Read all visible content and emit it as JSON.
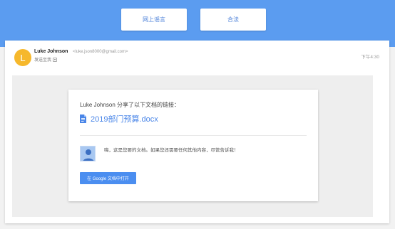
{
  "topbar": {
    "buttons": [
      {
        "label": "网上谣言"
      },
      {
        "label": "合法"
      }
    ]
  },
  "email": {
    "sender_name": "Luke Johnson",
    "sender_email": "<luke.json8000@gmail.com>",
    "to_label": "发送至我",
    "time": "下午4:30",
    "avatar_letter": "L",
    "avatar_color": "#f6b82c"
  },
  "share": {
    "title": "Luke Johnson 分享了以下文档的链接：",
    "doc_name": "2019部门预算.docx",
    "message": "嗨，这是您要的文档。如果您还需要任何其他内容，尽管告诉我！",
    "open_button": "在 Google 文档中打开",
    "accent_color": "#4b8ef0"
  }
}
